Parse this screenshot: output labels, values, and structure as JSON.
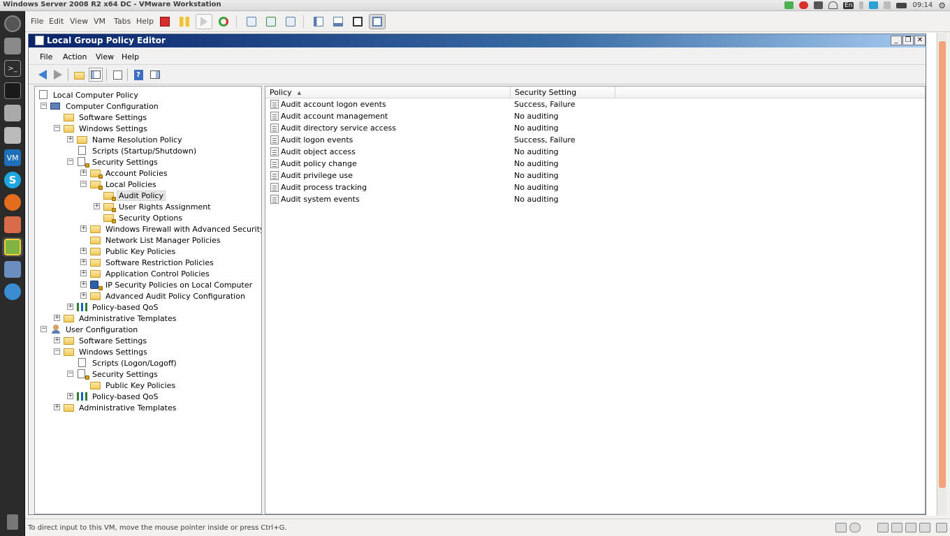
{
  "host": {
    "window_title": "Windows Server 2008 R2 x64 DC - VMware Workstation",
    "clock": "09:14",
    "keyboard_indicator": "En",
    "menu": [
      "File",
      "Edit",
      "View",
      "VM",
      "Tabs",
      "Help"
    ],
    "status_text": "To direct input to this VM, move the mouse pointer inside or press Ctrl+G."
  },
  "gpe": {
    "title": "Local Group Policy Editor",
    "menu": [
      "File",
      "Action",
      "View",
      "Help"
    ],
    "caption_buttons": {
      "minimize": "_",
      "restore": "❐",
      "close": "✕"
    }
  },
  "tree": [
    {
      "label": "Local Computer Policy",
      "expander": "",
      "icon": "policy-doc-icon"
    },
    {
      "label": "Computer Configuration",
      "expander": "−",
      "icon": "computer-icon"
    },
    {
      "label": "Software Settings",
      "expander": "",
      "icon": "folder-icon"
    },
    {
      "label": "Windows Settings",
      "expander": "−",
      "icon": "folder-icon"
    },
    {
      "label": "Name Resolution Policy",
      "expander": "+",
      "icon": "folder-icon"
    },
    {
      "label": "Scripts (Startup/Shutdown)",
      "expander": "",
      "icon": "script-icon"
    },
    {
      "label": "Security Settings",
      "expander": "−",
      "icon": "security-icon"
    },
    {
      "label": "Account Policies",
      "expander": "+",
      "icon": "locked-folder-icon"
    },
    {
      "label": "Local Policies",
      "expander": "−",
      "icon": "locked-folder-icon"
    },
    {
      "label": "Audit Policy",
      "expander": "",
      "icon": "locked-folder-icon"
    },
    {
      "label": "User Rights Assignment",
      "expander": "+",
      "icon": "locked-folder-icon"
    },
    {
      "label": "Security Options",
      "expander": "",
      "icon": "locked-folder-icon"
    },
    {
      "label": "Windows Firewall with Advanced Security",
      "expander": "+",
      "icon": "folder-icon"
    },
    {
      "label": "Network List Manager Policies",
      "expander": "",
      "icon": "folder-icon"
    },
    {
      "label": "Public Key Policies",
      "expander": "+",
      "icon": "folder-icon"
    },
    {
      "label": "Software Restriction Policies",
      "expander": "+",
      "icon": "folder-icon"
    },
    {
      "label": "Application Control Policies",
      "expander": "+",
      "icon": "folder-icon"
    },
    {
      "label": "IP Security Policies on Local Computer",
      "expander": "+",
      "icon": "ipsec-icon"
    },
    {
      "label": "Advanced Audit Policy Configuration",
      "expander": "+",
      "icon": "folder-icon"
    },
    {
      "label": "Policy-based QoS",
      "expander": "+",
      "icon": "qos-chart-icon"
    },
    {
      "label": "Administrative Templates",
      "expander": "+",
      "icon": "folder-icon"
    },
    {
      "label": "User Configuration",
      "expander": "−",
      "icon": "user-icon"
    },
    {
      "label": "Software Settings",
      "expander": "+",
      "icon": "folder-icon"
    },
    {
      "label": "Windows Settings",
      "expander": "−",
      "icon": "folder-icon"
    },
    {
      "label": "Scripts (Logon/Logoff)",
      "expander": "",
      "icon": "script-icon"
    },
    {
      "label": "Security Settings",
      "expander": "−",
      "icon": "security-icon"
    },
    {
      "label": "Public Key Policies",
      "expander": "",
      "icon": "folder-icon"
    },
    {
      "label": "Policy-based QoS",
      "expander": "+",
      "icon": "qos-chart-icon"
    },
    {
      "label": "Administrative Templates",
      "expander": "+",
      "icon": "folder-icon"
    }
  ],
  "list": {
    "columns": [
      "Policy",
      "Security Setting"
    ],
    "sort_arrow": "▲",
    "rows": [
      {
        "policy": "Audit account logon events",
        "setting": "Success, Failure"
      },
      {
        "policy": "Audit account management",
        "setting": "No auditing"
      },
      {
        "policy": "Audit directory service access",
        "setting": "No auditing"
      },
      {
        "policy": "Audit logon events",
        "setting": "Success, Failure"
      },
      {
        "policy": "Audit object access",
        "setting": "No auditing"
      },
      {
        "policy": "Audit policy change",
        "setting": "No auditing"
      },
      {
        "policy": "Audit privilege use",
        "setting": "No auditing"
      },
      {
        "policy": "Audit process tracking",
        "setting": "No auditing"
      },
      {
        "policy": "Audit system events",
        "setting": "No auditing"
      }
    ]
  }
}
